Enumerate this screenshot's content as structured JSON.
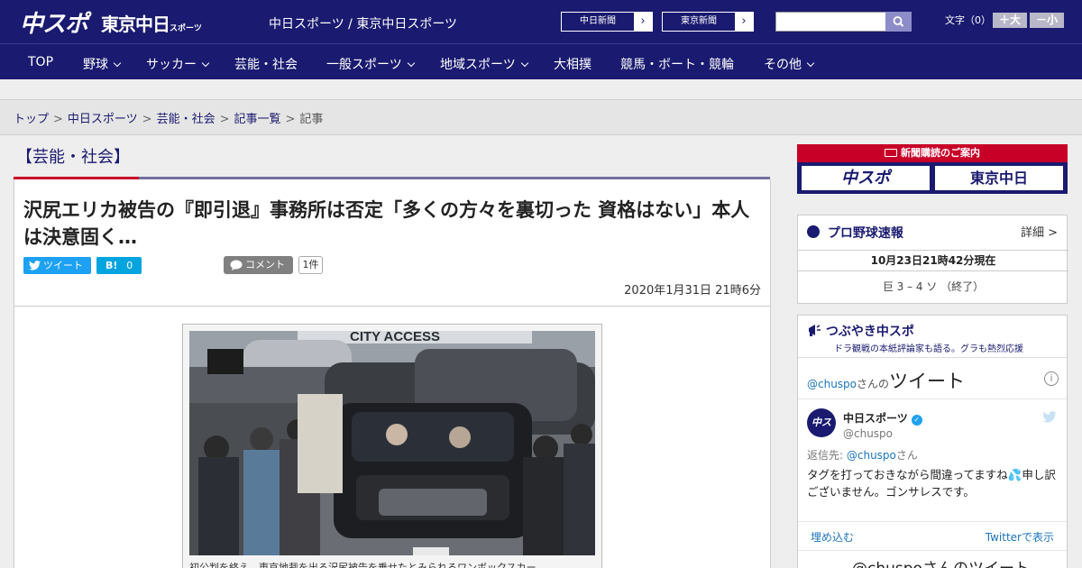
{
  "header": {
    "logo_chuspo": "中スポ",
    "logo_tokyo": "東京中日",
    "logo_tokyo_small": "スポーツ",
    "site_title": "中日スポーツ / 東京中日スポーツ",
    "paper_links": [
      "中日新聞",
      "東京新聞"
    ],
    "search_placeholder": "",
    "font_size_label": "文字（0）",
    "font_larger": "＋大",
    "font_smaller": "－小"
  },
  "nav": {
    "items": [
      "TOP",
      "野球",
      "サッカー",
      "芸能・社会",
      "一般スポーツ",
      "地域スポーツ",
      "大相撲",
      "競馬・ボート・競輪",
      "その他"
    ]
  },
  "breadcrumb": {
    "items": [
      "トップ",
      "中日スポーツ",
      "芸能・社会",
      "記事一覧"
    ],
    "current": "記事",
    "separator": ">"
  },
  "article": {
    "category": "【芸能・社会】",
    "headline": "沢尻エリカ被告の『即引退』事務所は否定「多くの方々を裏切った 資格はない」本人は決意固く…",
    "tweet_label": "ツイート",
    "hatebu_label": "B!",
    "hatebu_count": "0",
    "comment_label": "コメント",
    "comment_count": "1件",
    "date": "2020年1月31日 21時6分",
    "photo_sign": "CITY ACCESS",
    "caption": "初公判を終え、東京地裁を出る沢尻被告を乗せたとみられるワンボックスカー"
  },
  "sidebar": {
    "subscription_banner": "新聞購読のご案内",
    "subscription_logos": [
      "中スポ",
      "東京中日"
    ],
    "baseball": {
      "title": "プロ野球速報",
      "more": "詳細 >",
      "date": "10月23日21時42分現在",
      "score": "巨 3 – 4 ソ （終了）"
    },
    "twitter": {
      "title": "つぶやき中スポ",
      "subtitle": "ドラ観戦の本紙評論家も語る。グラも熱烈応援",
      "handle": "@chuspo",
      "handle_suffix": "さんの",
      "tweets_label": "ツイート",
      "account_name": "中日スポーツ",
      "account_user": "@chuspo",
      "avatar_text": "中スポ",
      "reply_label": "返信先:",
      "reply_handle": "@chuspo",
      "reply_suffix": "さん",
      "tweet_text": "タグを打っておきながら間違ってますね💦申し訳ございません。ゴンサレスです。",
      "embed_label": "埋め込む",
      "view_label": "Twitterで表示",
      "more_tweets": "@chuspoさんのツイート"
    }
  },
  "colors": {
    "brand_navy": "#1a1a70",
    "accent_red": "#c80028",
    "twitter_blue": "#1da1f2"
  }
}
